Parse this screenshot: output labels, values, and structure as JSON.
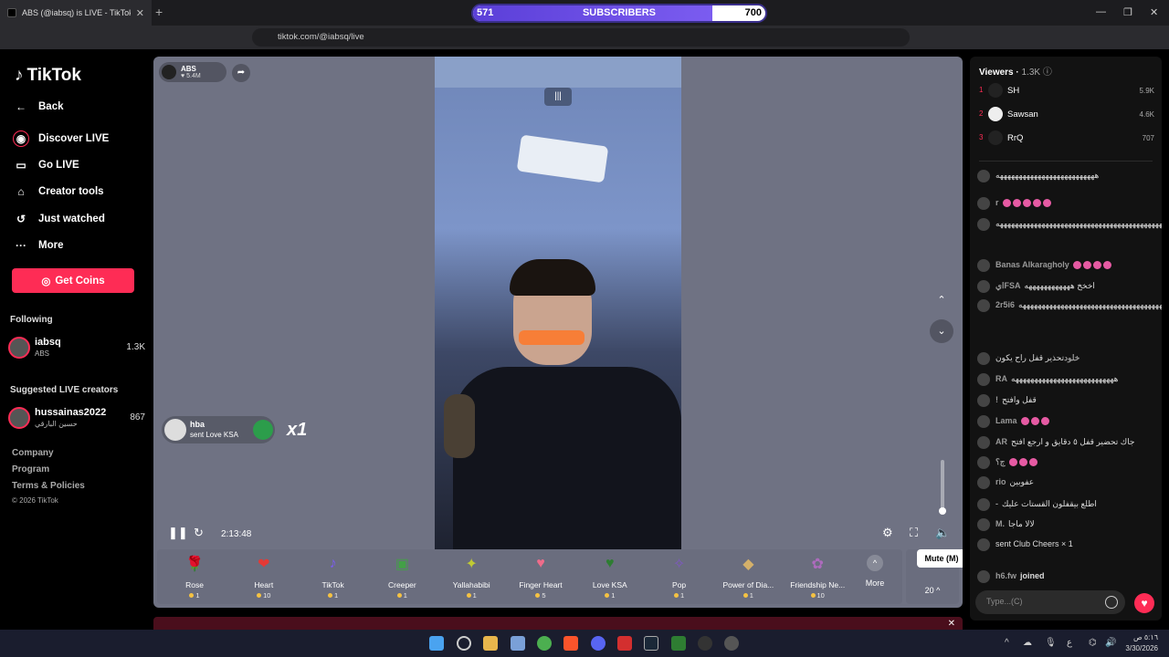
{
  "browser": {
    "tab_title": "ABS (@iabsq) is LIVE - TikTok",
    "url": "tiktok.com/@iabsq/live",
    "subs_widget": {
      "start": "571",
      "label": "SUBSCRIBERS",
      "end": "700",
      "progress_fraction": 0.82
    }
  },
  "sidebar": {
    "logo": "TikTok",
    "items": [
      {
        "label": "Back",
        "icon": "back-arrow-icon"
      },
      {
        "label": "Discover LIVE",
        "icon": "live-icon"
      },
      {
        "label": "Go LIVE",
        "icon": "camera-icon"
      },
      {
        "label": "Creator tools",
        "icon": "creator-tools-icon"
      },
      {
        "label": "Just watched",
        "icon": "history-icon"
      },
      {
        "label": "More",
        "icon": "more-icon"
      }
    ],
    "get_coins": "Get Coins",
    "following_title": "Following",
    "following": {
      "name": "iabsq",
      "sub": "ABS",
      "count": "1.3K"
    },
    "suggested_title": "Suggested LIVE creators",
    "suggested": {
      "name": "hussainas2022",
      "sub": "حسين البارقي",
      "count": "867"
    },
    "footer": [
      "Company",
      "Program",
      "Terms & Policies",
      "© 2026 TikTok"
    ]
  },
  "player": {
    "host_name": "ABS",
    "host_likes": "5.4M",
    "gift_note": {
      "user": "hba",
      "text": "sent Love KSA",
      "multiplier": "x1"
    },
    "time": "2:13:48",
    "mute_tooltip": "Mute (M)",
    "volume_fraction": 0.0,
    "gifts": [
      {
        "name": "Rose",
        "price": "1",
        "emoji": "🌹",
        "color": "#c2185b"
      },
      {
        "name": "Heart",
        "price": "10",
        "emoji": "❤",
        "color": "#e53935"
      },
      {
        "name": "TikTok",
        "price": "1",
        "emoji": "♪",
        "color": "#7b5cf0"
      },
      {
        "name": "Creeper",
        "price": "1",
        "emoji": "▣",
        "color": "#43a047"
      },
      {
        "name": "Yallahabibi",
        "price": "1",
        "emoji": "✦",
        "color": "#c0ca33"
      },
      {
        "name": "Finger Heart",
        "price": "5",
        "emoji": "♥",
        "color": "#ef6c8a"
      },
      {
        "name": "Love KSA",
        "price": "1",
        "emoji": "♥",
        "color": "#2e7d32"
      },
      {
        "name": "Pop",
        "price": "1",
        "emoji": "✧",
        "color": "#7e57c2"
      },
      {
        "name": "Power of Dia...",
        "price": "1",
        "emoji": "◆",
        "color": "#d4b06a"
      },
      {
        "name": "Friendship Ne...",
        "price": "10",
        "emoji": "✿",
        "color": "#ad6bbd"
      }
    ],
    "more_label": "More",
    "coin_count": "20"
  },
  "viewers": {
    "title": "Viewers",
    "count": "1.3K",
    "top": [
      {
        "rank": "1",
        "name": "SH",
        "score": "5.9K"
      },
      {
        "rank": "2",
        "name": "Sawsan",
        "score": "4.6K"
      },
      {
        "rank": "3",
        "name": "RrQ",
        "score": "707"
      }
    ]
  },
  "chat": [
    {
      "user": "",
      "text": "ههههههههههههههههههههههههههه"
    },
    {
      "user": "r",
      "text": "",
      "dots": 5
    },
    {
      "user": "سحاب",
      "text": "هههههههههههههههههههههههههههههههههههههههههههههههههه"
    },
    {
      "user": "Banas Alkaragholy",
      "text": "",
      "dots": 4
    },
    {
      "user": "ايFSA",
      "text": "اخخخ ههههههههههههه"
    },
    {
      "user": "2r5i6",
      "text": "هههههههههههههههههههههههههههههههههههههههههههههههههههههههههههههههه"
    },
    {
      "user": "خلود",
      "text": "تحذير قفل راح يكون"
    },
    {
      "user": "RA",
      "text": "هههههههههههههههههههههههههههه"
    },
    {
      "user": "!",
      "text": "قفل وافتح"
    },
    {
      "user": "Lama",
      "text": "",
      "dots": 3
    },
    {
      "user": "AR",
      "text": "جاك تحضير قفل ٥ دقايق و ارجع افتح"
    },
    {
      "user": "ج؟",
      "text": "",
      "dots": 3
    },
    {
      "user": "rio",
      "text": "عفوبين"
    },
    {
      "user": "-",
      "text": "اطلع بيقفلون القستات عليك"
    },
    {
      "user": "M.",
      "text": "لالا ماجا"
    },
    {
      "user": "",
      "text": "sent Club Cheers × 1"
    },
    {
      "user": "h6.fw",
      "text": "joined"
    }
  ],
  "chat_input_placeholder": "Type...(C)",
  "taskbar": {
    "time": "٥:١٦ ص",
    "date": "3/30/2026"
  }
}
